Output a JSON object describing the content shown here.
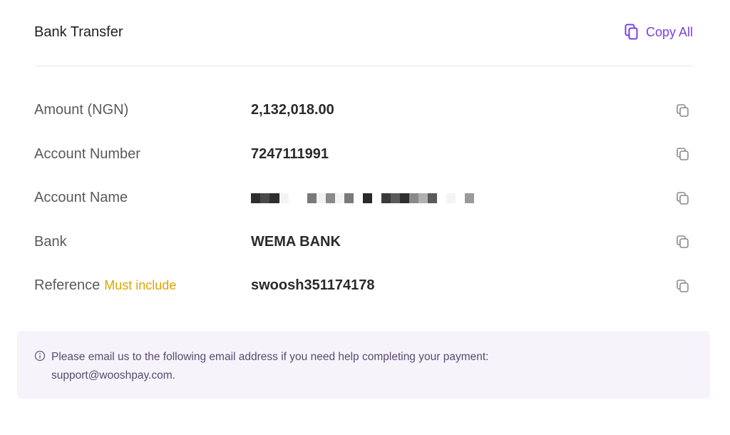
{
  "header": {
    "title": "Bank Transfer",
    "copy_all_label": "Copy All",
    "copy_all_icon": "copy-icon",
    "accent_color": "#7b3fe4"
  },
  "details": {
    "amount": {
      "label": "Amount (NGN)",
      "value": "2,132,018.00"
    },
    "account_number": {
      "label": "Account Number",
      "value": "7247111991"
    },
    "account_name": {
      "label": "Account Name",
      "value": "",
      "masked": true
    },
    "bank": {
      "label": "Bank",
      "value": "WEMA BANK"
    },
    "reference": {
      "label": "Reference",
      "note": "Must include",
      "note_color": "#e0a300",
      "value": "swoosh351174178"
    },
    "copy_icon": "copy-icon"
  },
  "notice": {
    "icon": "info-icon",
    "line1": "Please email us to the following email address if you need help completing your payment:",
    "line2": "support@wooshpay.com."
  }
}
